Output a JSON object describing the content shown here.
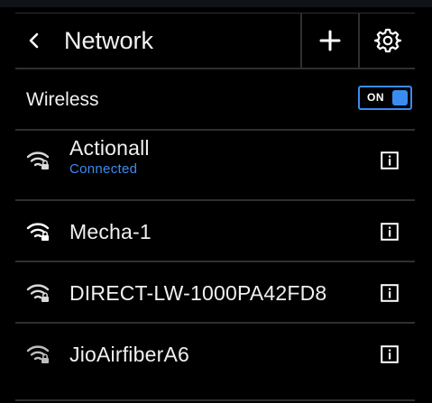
{
  "header": {
    "title": "Network",
    "back_icon": "chevron-left-icon",
    "add_icon": "plus-icon",
    "settings_icon": "gear-icon"
  },
  "wireless": {
    "label": "Wireless",
    "toggle_label": "ON",
    "enabled": true
  },
  "networks": [
    {
      "name": "Actionall",
      "status": "Connected",
      "icon": "wifi-lock-icon",
      "info_icon": "info-icon"
    },
    {
      "name": "Mecha-1",
      "status": "",
      "icon": "wifi-lock-icon",
      "info_icon": "info-icon"
    },
    {
      "name": "DIRECT-LW-1000PA42FD8",
      "status": "",
      "icon": "wifi-lock-icon",
      "info_icon": "info-icon"
    },
    {
      "name": "JioAirfiberA6",
      "status": "",
      "icon": "wifi-lock-icon",
      "info_icon": "info-icon"
    }
  ],
  "colors": {
    "background": "#000000",
    "accent": "#3b8cf0",
    "divider": "#2f2f2f",
    "text": "#f2f2f2"
  }
}
